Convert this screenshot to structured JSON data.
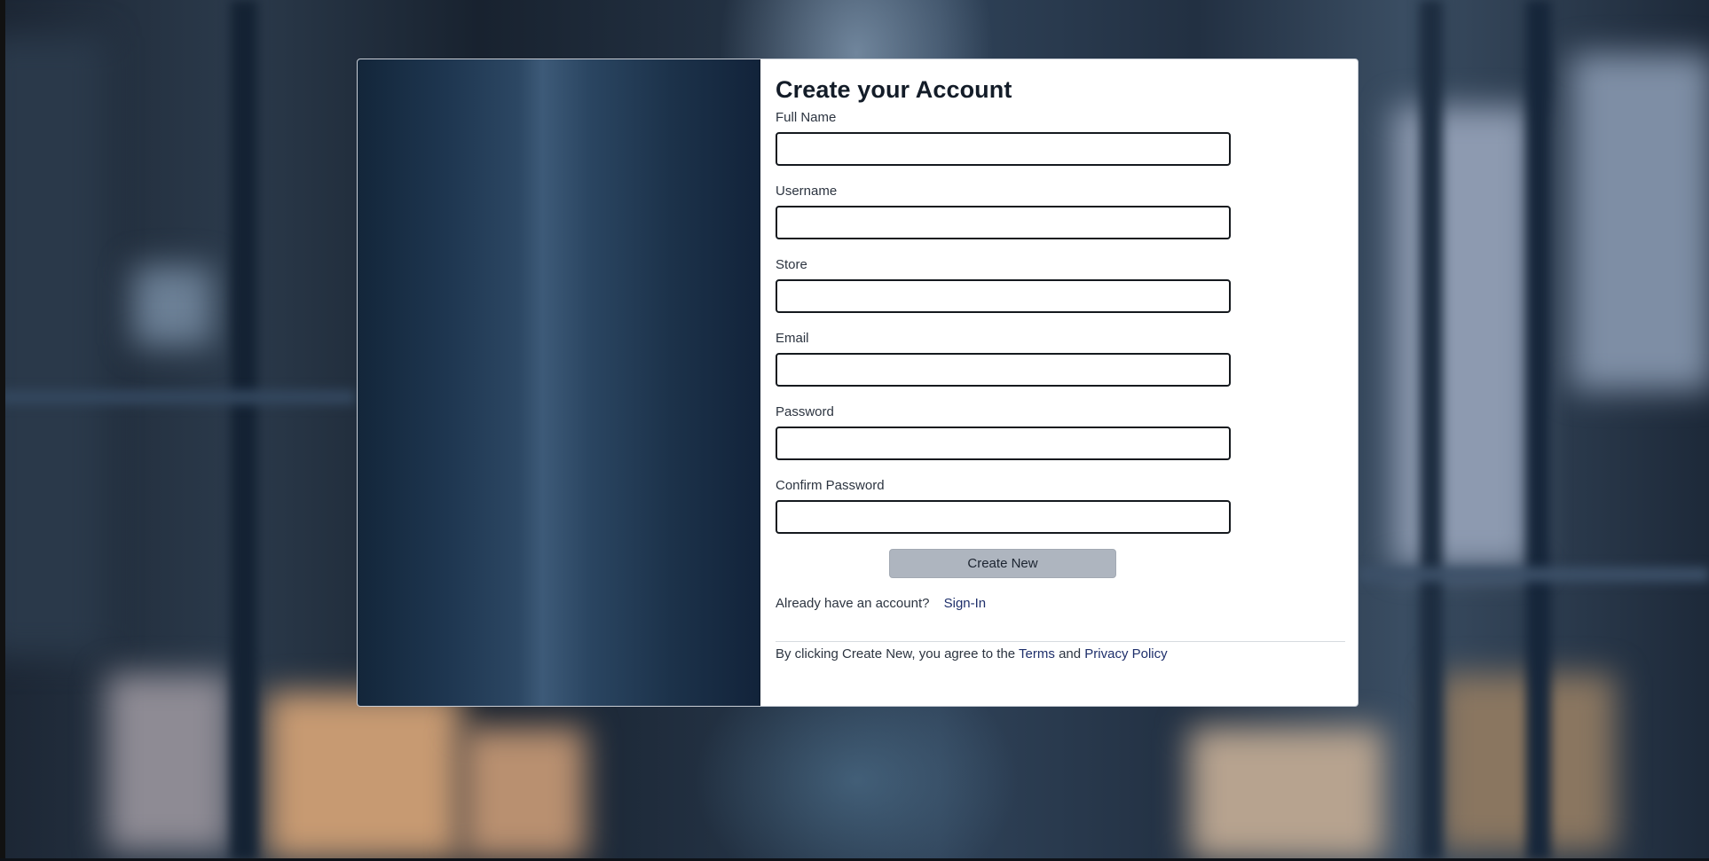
{
  "form": {
    "title": "Create your Account",
    "fields": [
      {
        "label": "Full Name",
        "value": ""
      },
      {
        "label": "Username",
        "value": ""
      },
      {
        "label": "Store",
        "value": ""
      },
      {
        "label": "Email",
        "value": ""
      },
      {
        "label": "Password",
        "value": ""
      },
      {
        "label": "Confirm Password",
        "value": ""
      }
    ],
    "submit_label": "Create New",
    "signin_prompt": "Already have an account?",
    "signin_link": "Sign-In",
    "terms_prefix": "By clicking Create New, you agree to the",
    "terms_link": "Terms",
    "terms_and": "and",
    "privacy_link": "Privacy Policy"
  },
  "colors": {
    "card_background": "#ffffff",
    "button_background": "#aeb5bf",
    "link_color": "#1e2f6b",
    "title_color": "#131c28"
  }
}
